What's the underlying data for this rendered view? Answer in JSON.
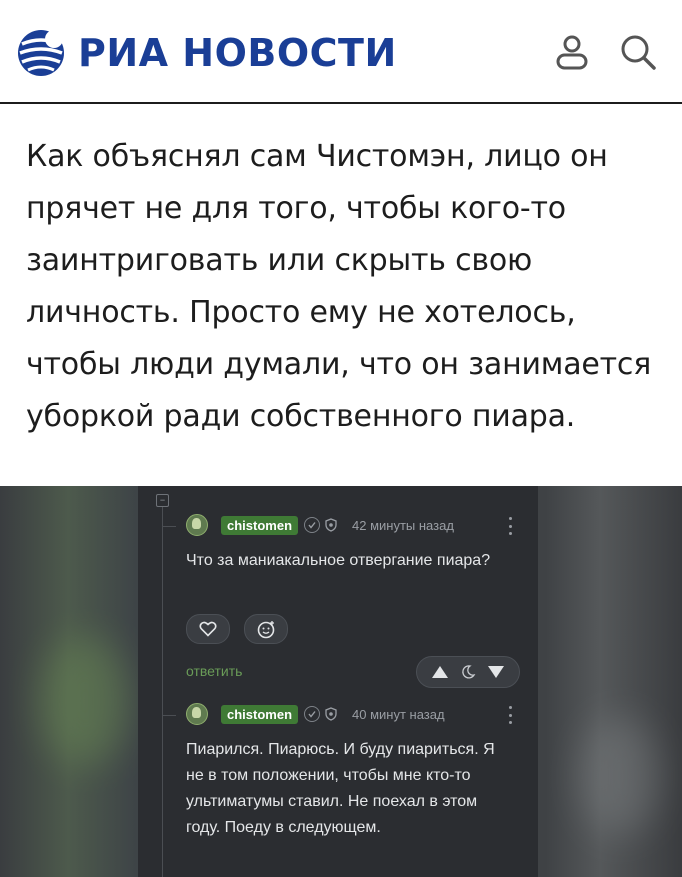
{
  "header": {
    "logo_text": "РИА НОВОСТИ",
    "brand_color": "#1a3e96"
  },
  "article": {
    "paragraph": "Как объяснял сам Чистомэн, лицо он прячет не для того, чтобы кого-то заинтриговать или скрыть свою личность. Просто ему не хотелось, чтобы люди думали, что он занимается уборкой ради собственного пиара."
  },
  "comments": [
    {
      "author": "chistomen",
      "time": "42 минуты назад",
      "text": "Что за маниакальное отвергание пиара?",
      "reply_label": "ответить"
    },
    {
      "author": "chistomen",
      "time": "40 минут назад",
      "text": "Пиарился. Пиарюсь. И буду пиариться. Я не в том положении, чтобы мне кто-то ультиматумы ставил. Не поехал в этом году. Поеду в следующем."
    }
  ],
  "icons": {
    "user": "user-icon",
    "search": "search-icon",
    "like": "heart-icon",
    "emoji": "emoji-icon",
    "upvote": "triangle-up-icon",
    "downvote": "triangle-down-icon",
    "save": "moon-icon"
  },
  "colors": {
    "nick_bg": "#3f7a35",
    "panel_bg": "#2b2d31",
    "reply_link": "#6a9c58"
  }
}
